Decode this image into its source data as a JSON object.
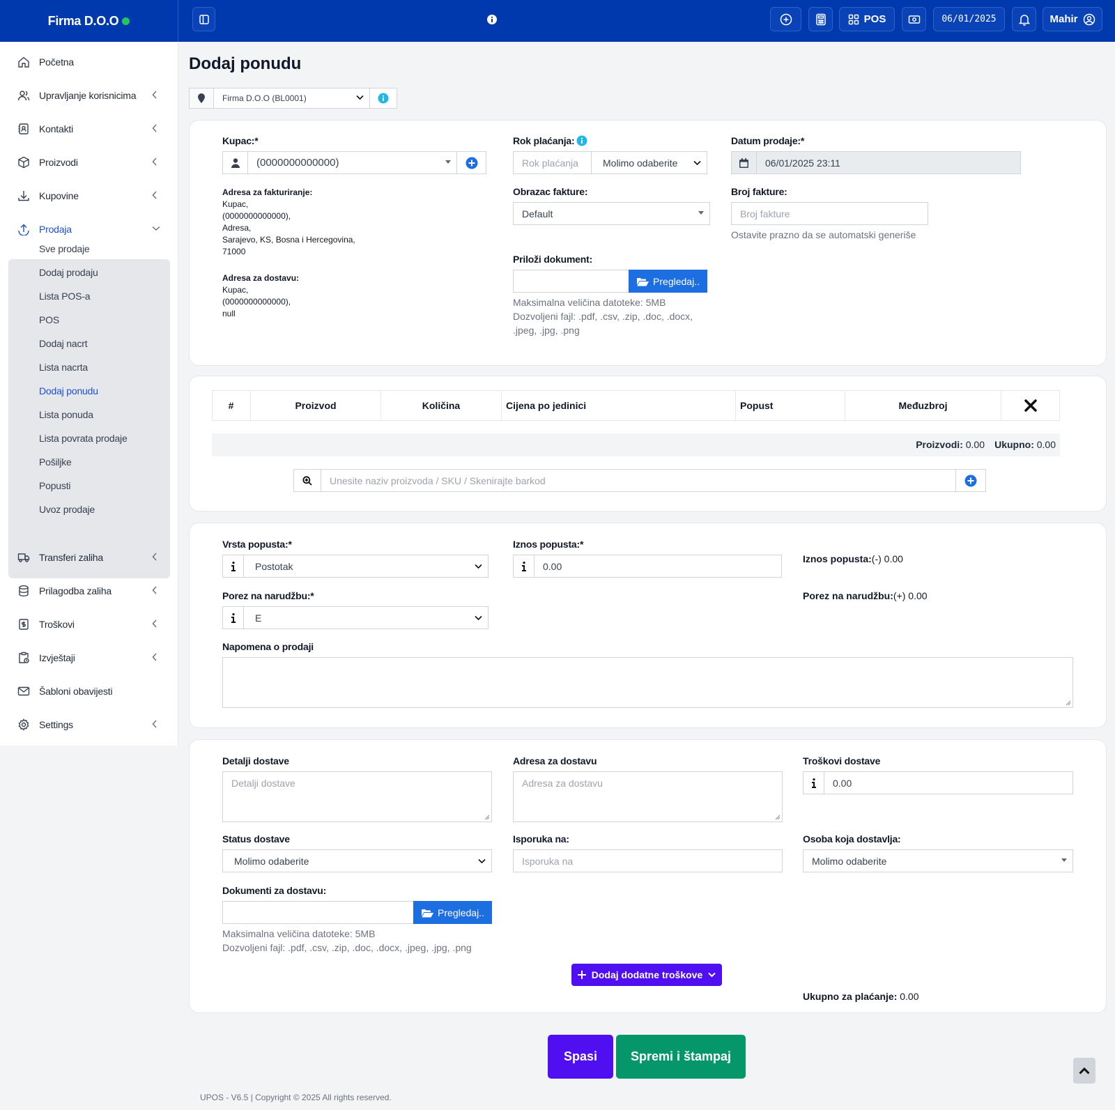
{
  "header": {
    "brand": "Firma D.O.O",
    "pos_label": "POS",
    "date": "06/01/2025",
    "user": "Mahir"
  },
  "colors": {
    "primary": "#0039ad",
    "accent_purple": "#4f0ff0",
    "accent_green": "#059669",
    "status_online": "#22c55e"
  },
  "sidebar": {
    "items": [
      {
        "label": "Početna",
        "icon": "home-icon"
      },
      {
        "label": "Upravljanje korisnicima",
        "icon": "users-icon"
      },
      {
        "label": "Kontakti",
        "icon": "contacts-icon"
      },
      {
        "label": "Proizvodi",
        "icon": "box-icon"
      },
      {
        "label": "Kupovine",
        "icon": "download-icon"
      },
      {
        "label": "Prodaja",
        "icon": "upload-icon"
      },
      {
        "label": "Transferi zaliha",
        "icon": "truck-icon"
      },
      {
        "label": "Prilagodba zaliha",
        "icon": "database-icon"
      },
      {
        "label": "Troškovi",
        "icon": "receipt-icon"
      },
      {
        "label": "Izvještaji",
        "icon": "report-icon"
      },
      {
        "label": "Šabloni obavijesti",
        "icon": "mail-icon"
      },
      {
        "label": "Settings",
        "icon": "gear-icon"
      }
    ],
    "sub_items": [
      "Sve prodaje",
      "Dodaj prodaju",
      "Lista POS-a",
      "POS",
      "Dodaj nacrt",
      "Lista nacrta",
      "Dodaj ponudu",
      "Lista ponuda",
      "Lista povrata prodaje",
      "Pošiljke",
      "Popusti",
      "Uvoz prodaje"
    ]
  },
  "page": {
    "title": "Dodaj ponudu",
    "location": "Firma D.O.O (BL0001)"
  },
  "form": {
    "customer_label": "Kupac:*",
    "customer_value": "(0000000000000)",
    "billing_title": "Adresa za fakturiranje:",
    "billing_lines": [
      "Kupac,",
      "(0000000000000),",
      "Adresa,",
      "Sarajevo, KS, Bosna i Hercegovina,",
      "71000"
    ],
    "shipping_title": "Adresa za dostavu:",
    "shipping_lines": [
      "Kupac,",
      "(0000000000000),",
      "null"
    ],
    "pay_term_label": "Rok plaćanja:",
    "pay_term_placeholder": "Rok plaćanja",
    "pay_term_select": "Molimo odaberite",
    "invoice_scheme_label": "Obrazac fakture:",
    "invoice_scheme_value": "Default",
    "attach_label": "Priloži dokument:",
    "browse_label": "Pregledaj..",
    "attach_help1": "Maksimalna veličina datoteke: 5MB",
    "attach_help2": "Dozvoljeni fajl: .pdf, .csv, .zip, .doc, .docx,",
    "attach_help3": ".jpeg, .jpg, .png",
    "sale_date_label": "Datum prodaje:*",
    "sale_date_value": "06/01/2025 23:11",
    "invoice_no_label": "Broj fakture:",
    "invoice_no_placeholder": "Broj fakture",
    "invoice_no_help": "Ostavite prazno da se automatski generiše"
  },
  "products": {
    "columns": [
      "#",
      "Proizvod",
      "Količina",
      "Cijena po jedinici",
      "Popust",
      "Međuzbroj"
    ],
    "items_label": "Proizvodi:",
    "items_value": "0.00",
    "total_label": "Ukupno:",
    "total_value": "0.00",
    "search_placeholder": "Unesite naziv proizvoda / SKU / Skenirajte barkod"
  },
  "discount": {
    "type_label": "Vrsta popusta:*",
    "type_value": "Postotak",
    "amount_label": "Iznos popusta:*",
    "amount_value": "0.00",
    "summary_label": "Iznos popusta:",
    "summary_value": "(-) 0.00",
    "tax_label": "Porez na narudžbu:*",
    "tax_value": "E",
    "tax_summary_label": "Porez na narudžbu:",
    "tax_summary_value": "(+) 0.00",
    "note_label": "Napomena o prodaji"
  },
  "shipping": {
    "details_label": "Detalji dostave",
    "details_placeholder": "Detalji dostave",
    "address_label": "Adresa za dostavu",
    "address_placeholder": "Adresa za dostavu",
    "charges_label": "Troškovi dostave",
    "charges_value": "0.00",
    "status_label": "Status dostave",
    "status_value": "Molimo odaberite",
    "delivered_to_label": "Isporuka na:",
    "delivered_to_placeholder": "Isporuka na",
    "person_label": "Osoba koja dostavlja:",
    "person_value": "Molimo odaberite",
    "docs_label": "Dokumenti za dostavu:",
    "browse_label": "Pregledaj..",
    "help1": "Maksimalna veličina datoteke: 5MB",
    "help2": "Dozvoljeni fajl: .pdf, .csv, .zip, .doc, .docx, .jpeg, .jpg, .png",
    "add_expenses": "Dodaj dodatne troškove",
    "payable_label": "Ukupno za plaćanje:",
    "payable_value": "0.00"
  },
  "actions": {
    "save": "Spasi",
    "save_print": "Spremi i štampaj"
  },
  "footer": "UPOS - V6.5 | Copyright © 2025 All rights reserved."
}
